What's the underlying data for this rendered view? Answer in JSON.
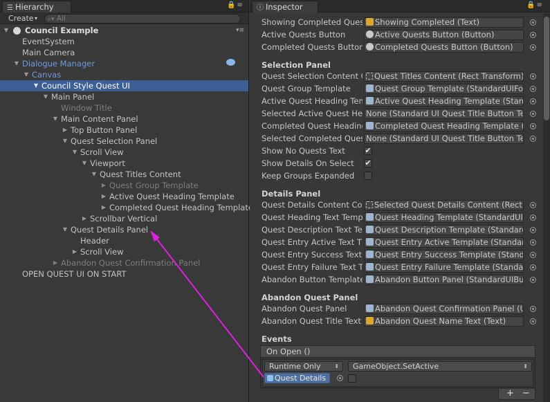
{
  "hierarchy": {
    "tab_label": "Hierarchy",
    "create_label": "Create",
    "search_placeholder": "All",
    "scene_name": "Council Example",
    "rows": [
      {
        "label": "EventSystem"
      },
      {
        "label": "Main Camera"
      },
      {
        "label": "Dialogue Manager"
      },
      {
        "label": "Canvas"
      },
      {
        "label": "Council Style Quest UI"
      },
      {
        "label": "Main Panel"
      },
      {
        "label": "Window Title"
      },
      {
        "label": "Main Content Panel"
      },
      {
        "label": "Top Button Panel"
      },
      {
        "label": "Quest Selection Panel"
      },
      {
        "label": "Scroll View"
      },
      {
        "label": "Viewport"
      },
      {
        "label": "Quest Titles Content"
      },
      {
        "label": "Quest Group Template"
      },
      {
        "label": "Active Quest Heading Template"
      },
      {
        "label": "Completed Quest Heading Template"
      },
      {
        "label": "Scrollbar Vertical"
      },
      {
        "label": "Quest Details Panel"
      },
      {
        "label": "Header"
      },
      {
        "label": "Scroll View"
      },
      {
        "label": "Abandon Quest Confirmation Panel"
      },
      {
        "label": "OPEN QUEST UI ON START"
      }
    ]
  },
  "inspector": {
    "tab_label": "Inspector",
    "fields_top": [
      {
        "label": "Showing Completed Quest",
        "value": "Showing Completed (Text)"
      },
      {
        "label": "Active Quests Button",
        "value": "Active Quests Button (Button)"
      },
      {
        "label": "Completed Quests Button",
        "value": "Completed Quests Button (Button)"
      }
    ],
    "selection_panel": {
      "header": "Selection Panel",
      "fields": [
        {
          "label": "Quest Selection Content C",
          "value": "Quest Titles Content (Rect Transform)"
        },
        {
          "label": "Quest Group Template",
          "value": "Quest Group Template (StandardUIFo"
        },
        {
          "label": "Active Quest Heading Tem",
          "value": "Active Quest Heading Template (Stan"
        },
        {
          "label": "Selected Active Quest He",
          "value": "None (Standard UI Quest Title Button Te"
        },
        {
          "label": "Completed Quest Heading",
          "value": "Completed Quest Heading Template ("
        },
        {
          "label": "Selected Completed Ques",
          "value": "None (Standard UI Quest Title Button Te"
        }
      ],
      "toggles": [
        {
          "label": "Show No Quests Text",
          "checked": true
        },
        {
          "label": "Show Details On Select",
          "checked": true
        },
        {
          "label": "Keep Groups Expanded",
          "checked": false
        }
      ]
    },
    "details_panel": {
      "header": "Details Panel",
      "fields": [
        {
          "label": "Quest Details Content Co",
          "value": "Selected Quest Details Content (Rect"
        },
        {
          "label": "Quest Heading Text Temp",
          "value": "Quest Heading Template (StandardUIT"
        },
        {
          "label": "Quest Description Text Te",
          "value": "Quest Description Template (Standard"
        },
        {
          "label": "Quest Entry Active Text T",
          "value": "Quest Entry Active Template (Standar"
        },
        {
          "label": "Quest Entry Success Text",
          "value": "Quest Entry Success Template (Stand"
        },
        {
          "label": "Quest Entry Failure Text T",
          "value": "Quest Entry Failure Template (Standa"
        },
        {
          "label": "Abandon Button Template",
          "value": "Abandon Button Panel (StandardUIBu"
        }
      ]
    },
    "abandon_panel": {
      "header": "Abandon Quest Panel",
      "fields": [
        {
          "label": "Abandon Quest Panel",
          "value": "Abandon Quest Confirmation Panel (U"
        },
        {
          "label": "Abandon Quest Title Text",
          "value": "Abandon Quest Name Text (Text)"
        }
      ]
    },
    "events": {
      "header": "Events",
      "event_name": "On Open ()",
      "runtime_option": "Runtime Only",
      "function": "GameObject.SetActive",
      "target_object": "Quest Details",
      "target_checked": false,
      "add_label": "+",
      "remove_label": "−"
    }
  },
  "colors": {
    "selection_highlight": "#3e5f96",
    "prefab_blue": "#6f9be0",
    "annotation_arrow": "#e020e0"
  }
}
